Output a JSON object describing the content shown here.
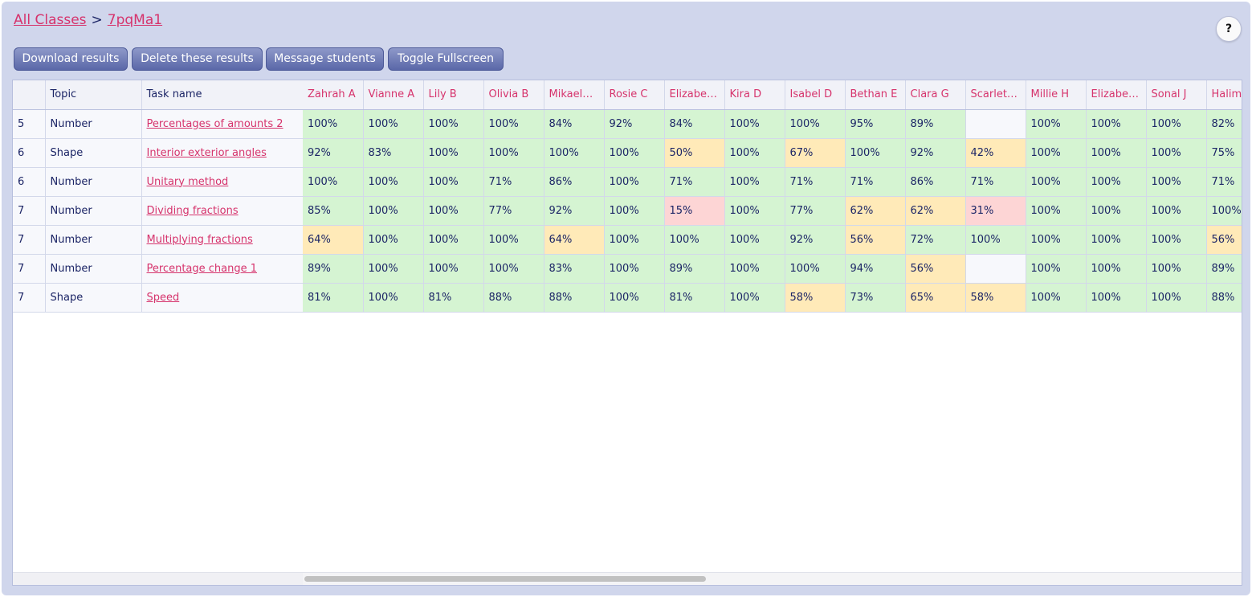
{
  "breadcrumb": {
    "root": "All Classes",
    "separator": ">",
    "current": "7pqMa1"
  },
  "help": {
    "label": "?"
  },
  "toolbar": {
    "download": "Download results",
    "delete": "Delete these results",
    "message": "Message students",
    "fullscreen": "Toggle Fullscreen"
  },
  "columns": {
    "num": "",
    "topic": "Topic",
    "task": "Task name"
  },
  "students": [
    "Zahrah A",
    "Vianne A",
    "Lily B",
    "Olivia B",
    "Mikaela…",
    "Rosie C",
    "Elizabet…",
    "Kira D",
    "Isabel D",
    "Bethan E",
    "Clara G",
    "Scarlett…",
    "Millie H",
    "Elizabet…",
    "Sonal J",
    "Halim"
  ],
  "tasks": [
    {
      "num": "5",
      "topic": "Number",
      "name": "Percentages of amounts 2",
      "scores": [
        "100%",
        "100%",
        "100%",
        "100%",
        "84%",
        "92%",
        "84%",
        "100%",
        "100%",
        "95%",
        "89%",
        "",
        "100%",
        "100%",
        "100%",
        "82%"
      ]
    },
    {
      "num": "6",
      "topic": "Shape",
      "name": "Interior exterior angles",
      "scores": [
        "92%",
        "83%",
        "100%",
        "100%",
        "100%",
        "100%",
        "50%",
        "100%",
        "67%",
        "100%",
        "92%",
        "42%",
        "100%",
        "100%",
        "100%",
        "75%"
      ]
    },
    {
      "num": "6",
      "topic": "Number",
      "name": "Unitary method",
      "scores": [
        "100%",
        "100%",
        "100%",
        "71%",
        "86%",
        "100%",
        "71%",
        "100%",
        "71%",
        "71%",
        "86%",
        "71%",
        "100%",
        "100%",
        "100%",
        "71%"
      ]
    },
    {
      "num": "7",
      "topic": "Number",
      "name": "Dividing fractions",
      "scores": [
        "85%",
        "100%",
        "100%",
        "77%",
        "92%",
        "100%",
        "15%",
        "100%",
        "77%",
        "62%",
        "62%",
        "31%",
        "100%",
        "100%",
        "100%",
        "100%"
      ]
    },
    {
      "num": "7",
      "topic": "Number",
      "name": "Multiplying fractions",
      "scores": [
        "64%",
        "100%",
        "100%",
        "100%",
        "64%",
        "100%",
        "100%",
        "100%",
        "92%",
        "56%",
        "72%",
        "100%",
        "100%",
        "100%",
        "100%",
        "56%"
      ]
    },
    {
      "num": "7",
      "topic": "Number",
      "name": "Percentage change 1",
      "scores": [
        "89%",
        "100%",
        "100%",
        "100%",
        "83%",
        "100%",
        "89%",
        "100%",
        "100%",
        "94%",
        "56%",
        "",
        "100%",
        "100%",
        "100%",
        "89%"
      ]
    },
    {
      "num": "7",
      "topic": "Shape",
      "name": "Speed",
      "scores": [
        "81%",
        "100%",
        "81%",
        "88%",
        "88%",
        "100%",
        "81%",
        "100%",
        "58%",
        "73%",
        "65%",
        "58%",
        "100%",
        "100%",
        "100%",
        "88%"
      ]
    }
  ],
  "score_colors": {
    "high": "#d5f4d2",
    "medium": "#ffeab8",
    "low": "#fdd5d5",
    "none": "#f7f8fc"
  },
  "accent_color": "#d6336c"
}
